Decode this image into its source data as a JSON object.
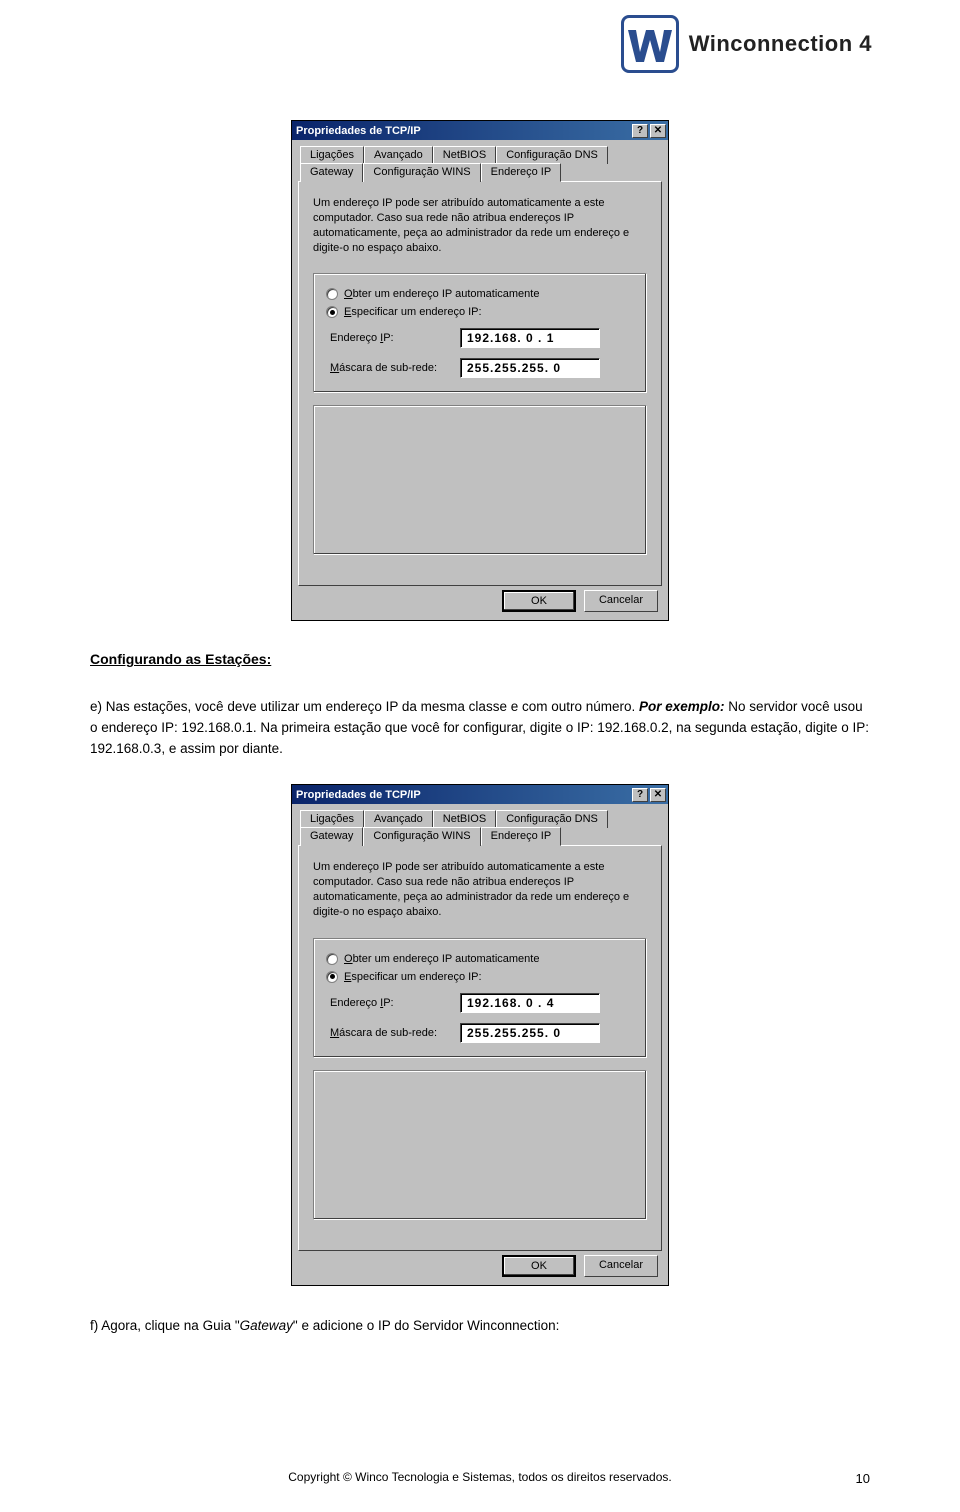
{
  "header": {
    "logo_text": "Winconnection 4"
  },
  "dialog": {
    "title": "Propriedades de TCP/IP",
    "help_btn": "?",
    "close_btn": "✕",
    "tabs_row1": [
      "Ligações",
      "Avançado",
      "NetBIOS",
      "Configuração DNS"
    ],
    "tabs_row2": [
      "Gateway",
      "Configuração WINS",
      "Endereço IP"
    ],
    "active_tab": "Endereço IP",
    "description": "Um endereço IP pode ser atribuído automaticamente a este computador. Caso sua rede não atribua endereços IP automaticamente, peça ao administrador da rede um endereço e digite-o no espaço abaixo.",
    "radio_auto_label": "Obter um endereço IP automaticamente",
    "radio_auto_ul": "O",
    "radio_spec_label": "Especificar um endereço IP:",
    "radio_spec_ul": "E",
    "field_ip_label": "Endereço IP:",
    "field_ip_ul": "I",
    "field_mask_label": "Máscara de sub-rede:",
    "field_mask_ul": "M",
    "ok_label": "OK",
    "cancel_label": "Cancelar"
  },
  "dialog1_values": {
    "ip": "192.168. 0 .  1",
    "mask": "255.255.255. 0"
  },
  "dialog2_values": {
    "ip": "192.168. 0 .  4",
    "mask": "255.255.255. 0"
  },
  "body": {
    "section_title": "Configurando as Estações:",
    "p1_prefix": "e) Nas estações, você deve utilizar um endereço IP da mesma classe e com outro número. ",
    "p1_bold": "Por exemplo:",
    "p1_rest": " No servidor você usou o endereço IP: 192.168.0.1. Na primeira estação que você for configurar, digite o IP: 192.168.0.2, na segunda estação, digite o IP: 192.168.0.3, e assim por diante.",
    "p2_a": "f) Agora, clique na Guia \"",
    "p2_gateway": "Gateway",
    "p2_b": "\" e adicione o IP do Servidor Winconnection:"
  },
  "footer": {
    "text": "Copyright © Winco Tecnologia e Sistemas, todos os direitos reservados.",
    "page": "10"
  }
}
